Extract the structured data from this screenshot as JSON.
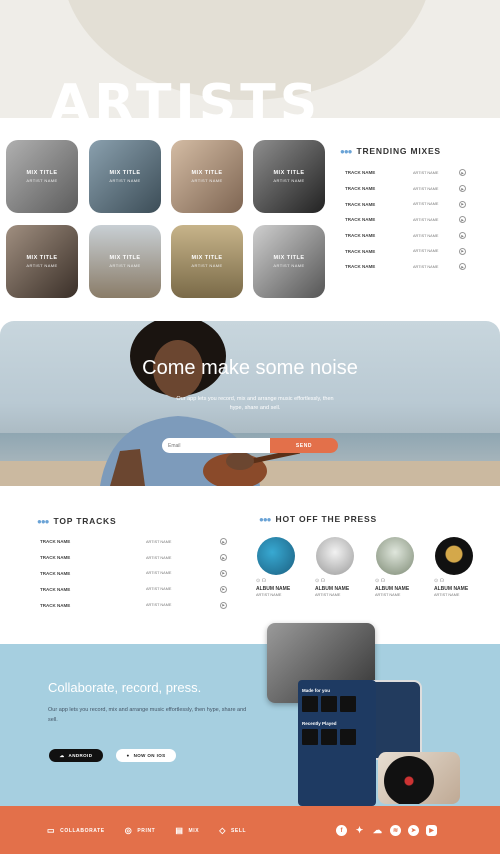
{
  "hero": {
    "title": "ARTISTS"
  },
  "mixes": [
    {
      "title": "MIX TITLE",
      "artist": "ARTIST NAME",
      "bg": "#8c8c8c"
    },
    {
      "title": "MIX TITLE",
      "artist": "ARTIST NAME",
      "bg": "#5d7a8f"
    },
    {
      "title": "MIX TITLE",
      "artist": "ARTIST NAME",
      "bg": "#b59c86"
    },
    {
      "title": "MIX TITLE",
      "artist": "ARTIST NAME",
      "bg": "#4a4a4a"
    },
    {
      "title": "MIX TITLE",
      "artist": "ARTIST NAME",
      "bg": "#6b5b4e"
    },
    {
      "title": "MIX TITLE",
      "artist": "ARTIST NAME",
      "bg": "#a9a6a0"
    },
    {
      "title": "MIX TITLE",
      "artist": "ARTIST NAME",
      "bg": "#9c8b6a"
    },
    {
      "title": "MIX TITLE",
      "artist": "ARTIST NAME",
      "bg": "#777777"
    }
  ],
  "trending": {
    "title": "TRENDING MIXES",
    "rows": [
      {
        "track": "TRACK NAME",
        "artist": "ARTIST NAME"
      },
      {
        "track": "TRACK NAME",
        "artist": "ARTIST NAME"
      },
      {
        "track": "TRACK NAME",
        "artist": "ARTIST NAME"
      },
      {
        "track": "TRACK NAME",
        "artist": "ARTIST NAME"
      },
      {
        "track": "TRACK NAME",
        "artist": "ARTIST NAME"
      },
      {
        "track": "TRACK NAME",
        "artist": "ARTIST NAME"
      },
      {
        "track": "TRACK NAME",
        "artist": "ARTIST NAME"
      }
    ]
  },
  "banner": {
    "heading": "Come make some noise",
    "text": "Our app lets you record, mix and arrange music effortlessly, then hype, share and sell.",
    "email_placeholder": "Email",
    "send_label": "SEND"
  },
  "top_tracks": {
    "title": "TOP TRACKS",
    "rows": [
      {
        "track": "TRACK NAME",
        "artist": "ARTIST NAME"
      },
      {
        "track": "TRACK NAME",
        "artist": "ARTIST NAME"
      },
      {
        "track": "TRACK NAME",
        "artist": "ARTIST NAME"
      },
      {
        "track": "TRACK NAME",
        "artist": "ARTIST NAME"
      },
      {
        "track": "TRACK NAME",
        "artist": "ARTIST NAME"
      }
    ]
  },
  "press": {
    "title": "HOT OFF THE PRESS",
    "albums": [
      {
        "name": "ALBUM NAME",
        "artist": "ARTIST NAME",
        "color": "#2a8fb8"
      },
      {
        "name": "ALBUM NAME",
        "artist": "ARTIST NAME",
        "color": "#d6d6d6"
      },
      {
        "name": "ALBUM NAME",
        "artist": "ARTIST NAME",
        "color": "#b6c3b0"
      },
      {
        "name": "ALBUM NAME",
        "artist": "ARTIST NAME",
        "color": "#111111"
      }
    ]
  },
  "collab": {
    "heading": "Collaborate, record, press.",
    "text": "Our app lets you record, mix and arrange music effortlessly, then hype, share and sell.",
    "android_label": "ANDROID",
    "ios_label": "NOW ON IOS",
    "phone": {
      "heading": "Made for you",
      "recent": "Recently Played"
    }
  },
  "footer": {
    "nav": [
      {
        "label": "COLLABORATE",
        "icon": "chat-icon"
      },
      {
        "label": "PRINT",
        "icon": "disc-icon"
      },
      {
        "label": "MIX",
        "icon": "sliders-icon"
      },
      {
        "label": "SELL",
        "icon": "tag-icon"
      }
    ],
    "social": [
      "facebook-icon",
      "twitter-icon",
      "soundcloud-icon",
      "spotify-icon",
      "pinterest-icon",
      "youtube-icon"
    ]
  },
  "colors": {
    "accent": "#e3704a",
    "blue": "#a6cfe0",
    "dots": "#6aa3d6"
  }
}
